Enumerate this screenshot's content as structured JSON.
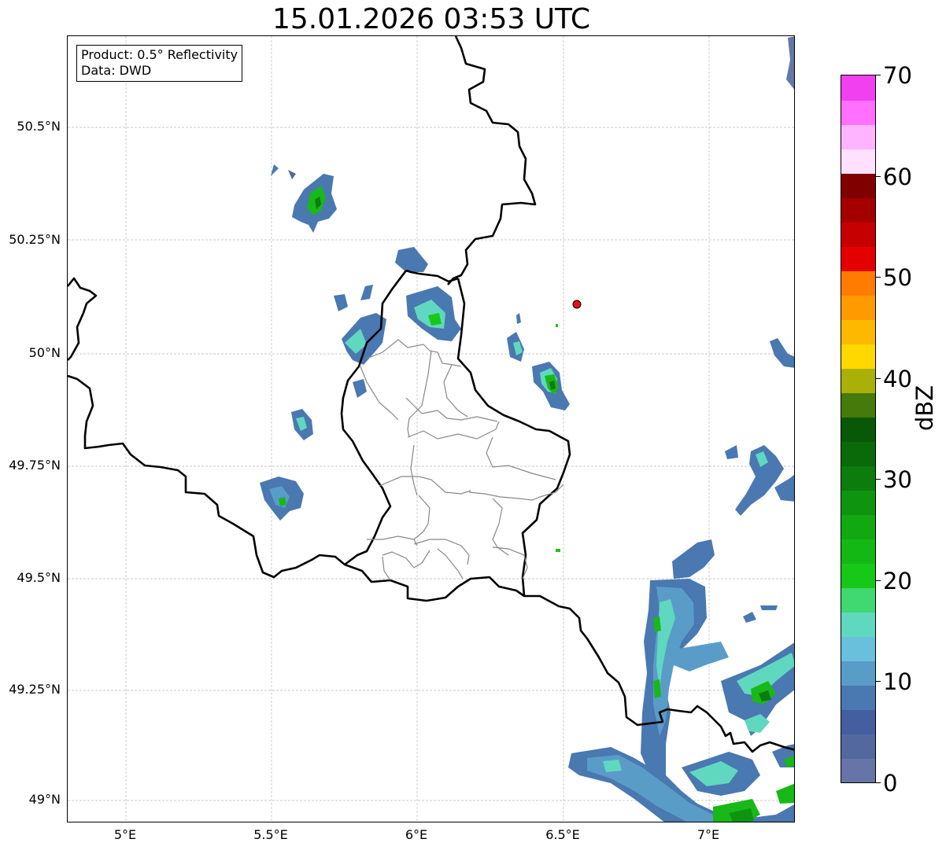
{
  "title": "15.01.2026 03:53 UTC",
  "info_box": {
    "product": "Product: 0.5° Reflectivity",
    "source": "Data: DWD"
  },
  "latitude_labels": [
    "50.5°N",
    "50.25°N",
    "50°N",
    "49.75°N",
    "49.5°N",
    "49.25°N",
    "49°N"
  ],
  "longitude_labels": [
    "5°E",
    "5.5°E",
    "6°E",
    "6.5°E",
    "7°E"
  ],
  "colorbar": {
    "unit": "dBZ",
    "tick_labels": [
      "0",
      "10",
      "20",
      "30",
      "40",
      "50",
      "60",
      "70"
    ],
    "colors": [
      "#6674a8",
      "#5468a0",
      "#445ea0",
      "#4a78b0",
      "#5a9cc8",
      "#68c0dc",
      "#60d8c0",
      "#40d870",
      "#18c818",
      "#14b814",
      "#12a812",
      "#0f9410",
      "#0c7c0c",
      "#0a6a0a",
      "#085808",
      "#467a0a",
      "#aab008",
      "#ffd800",
      "#ffb800",
      "#ff9a00",
      "#ff7c00",
      "#e40000",
      "#c60000",
      "#a40000",
      "#800000",
      "#ffe0ff",
      "#ffb4ff",
      "#ff70ff",
      "#f040f0"
    ]
  },
  "site_marker_color": "#ee1111",
  "border_color": "#000000",
  "region_line_color": "#888888"
}
